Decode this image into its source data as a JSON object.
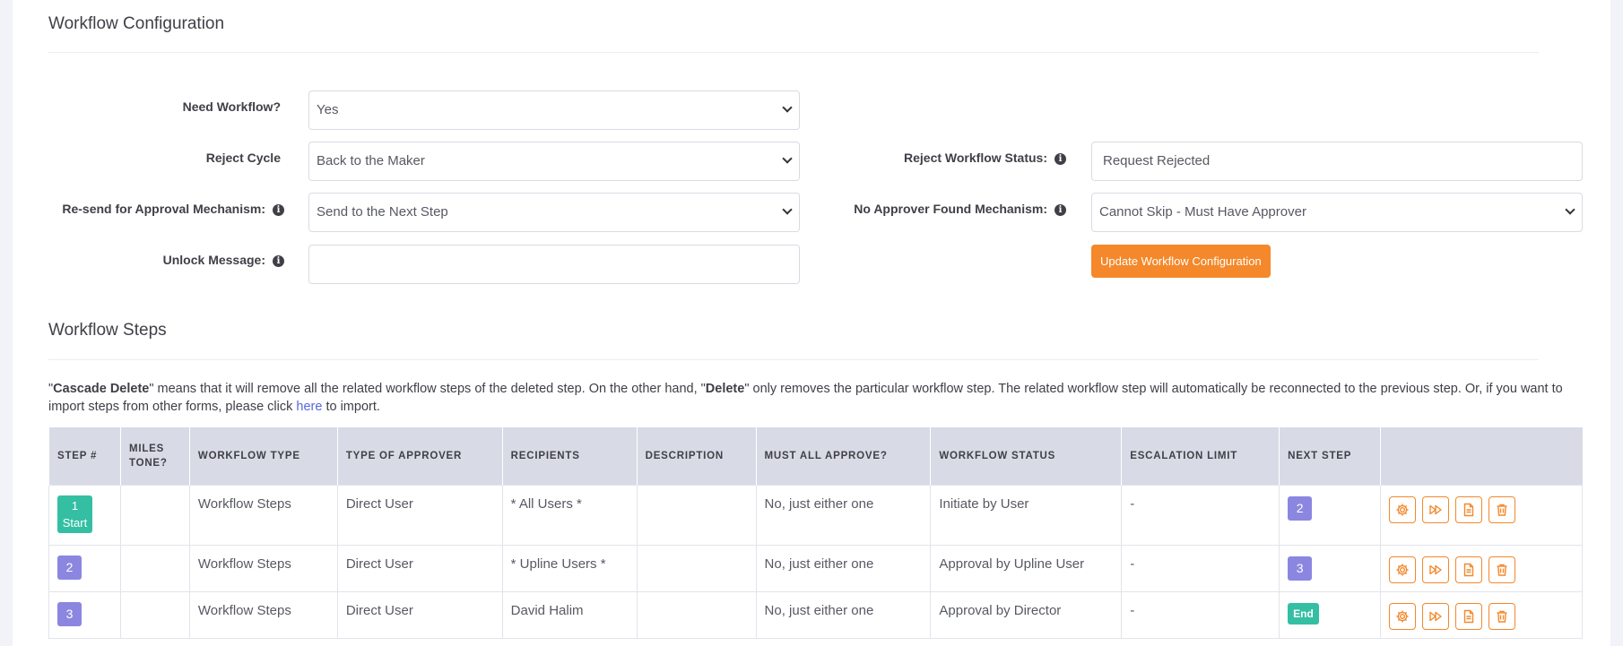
{
  "config": {
    "title": "Workflow Configuration",
    "need_workflow": {
      "label": "Need Workflow?",
      "value": "Yes"
    },
    "reject_cycle": {
      "label": "Reject Cycle",
      "value": "Back to the Maker"
    },
    "resend": {
      "label": "Re-send for Approval Mechanism:",
      "value": "Send to the Next Step"
    },
    "unlock": {
      "label": "Unlock Message:",
      "value": ""
    },
    "reject_status": {
      "label": "Reject Workflow Status:",
      "value": "Request Rejected"
    },
    "no_approver": {
      "label": "No Approver Found Mechanism:",
      "value": "Cannot Skip - Must Have Approver"
    },
    "update_button": "Update Workflow Configuration",
    "info_glyph": "i"
  },
  "steps": {
    "title": "Workflow Steps",
    "desc_q1": "\"",
    "desc_b1": "Cascade Delete",
    "desc_t1": "\" means that it will remove all the related workflow steps of the deleted step. On the other hand, \"",
    "desc_b2": "Delete",
    "desc_t2": "\" only removes the particular workflow step. The related workflow step will automatically be reconnected to the previous step. Or, if you want to import steps from other forms, please click ",
    "desc_link": "here",
    "desc_t3": " to import.",
    "columns": [
      "STEP #",
      "MILES TONE?",
      "WORKFLOW TYPE",
      "TYPE OF APPROVER",
      "RECIPIENTS",
      "DESCRIPTION",
      "MUST ALL APPROVE?",
      "WORKFLOW STATUS",
      "ESCALATION LIMIT",
      "NEXT STEP",
      ""
    ],
    "rows": [
      {
        "step": "1",
        "step_sub": "Start",
        "milestone": "",
        "type": "Workflow Steps",
        "approver": "Direct User",
        "recipients": "* All Users *",
        "description": "",
        "must_all": "No, just either one",
        "status": "Initiate by User",
        "escalation": "-",
        "next": "2"
      },
      {
        "step": "2",
        "milestone": "",
        "type": "Workflow Steps",
        "approver": "Direct User",
        "recipients": "* Upline Users *",
        "description": "",
        "must_all": "No, just either one",
        "status": "Approval by Upline User",
        "escalation": "-",
        "next": "3"
      },
      {
        "step": "3",
        "milestone": "",
        "type": "Workflow Steps",
        "approver": "Direct User",
        "recipients": "David Halim",
        "description": "",
        "must_all": "No, just either one",
        "status": "Approval by Director",
        "escalation": "-",
        "next": "End"
      }
    ],
    "action_icons": [
      "gear-icon",
      "fast-forward-icon",
      "document-icon",
      "trash-icon"
    ]
  },
  "colors": {
    "accent": "#f4882b",
    "start_badge": "#34bfa3",
    "step_badge": "#8b87e0",
    "link": "#5867dd",
    "header_bg": "#d8dbe5"
  }
}
